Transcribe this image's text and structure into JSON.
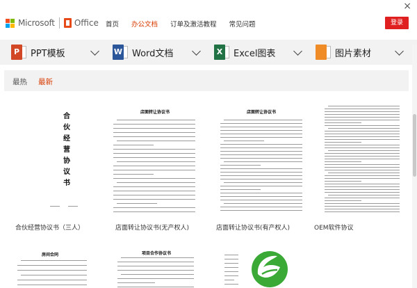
{
  "header": {
    "close_glyph": "×",
    "logo_microsoft": "Microsoft",
    "logo_office": "Office",
    "nav": [
      "首页",
      "办公文档",
      "订单及激活教程",
      "常见问题"
    ],
    "nav_active_index": 1,
    "login_label": "登录"
  },
  "categories": [
    {
      "label": "PPT模板",
      "icon": "ppt-icon",
      "letter": "P",
      "color": "#d24726"
    },
    {
      "label": "Word文档",
      "icon": "word-icon",
      "letter": "W",
      "color": "#2b579a"
    },
    {
      "label": "Excel图表",
      "icon": "excel-icon",
      "letter": "X",
      "color": "#217346"
    },
    {
      "label": "图片素材",
      "icon": "picture-icon",
      "letter": "",
      "color": "#f08c28"
    }
  ],
  "filters": [
    "最热",
    "最新"
  ],
  "filters_active_index": 1,
  "documents": [
    {
      "caption": "合伙经营协议书（三人）",
      "vertical_title": "合伙经营协议书"
    },
    {
      "caption": "店面转让协议书(无产权人)",
      "title": "店面转让协议书"
    },
    {
      "caption": "店面转让协议书(有产权人)",
      "title": "店面转让协议书"
    },
    {
      "caption": "OEM软件协议",
      "title": ""
    },
    {
      "caption": "",
      "title": "房间合同"
    },
    {
      "caption": "",
      "title": "项目合作协议书"
    },
    {
      "caption": "",
      "title": ""
    }
  ],
  "colors": {
    "accent": "#d83b01",
    "login_bg": "#e02020",
    "bar_bg": "#f2f2f2",
    "ms_red": "#f25022",
    "ms_green": "#7fba00",
    "ms_blue": "#00a4ef",
    "ms_yellow": "#ffb900",
    "watermark_green": "#3aa935"
  }
}
